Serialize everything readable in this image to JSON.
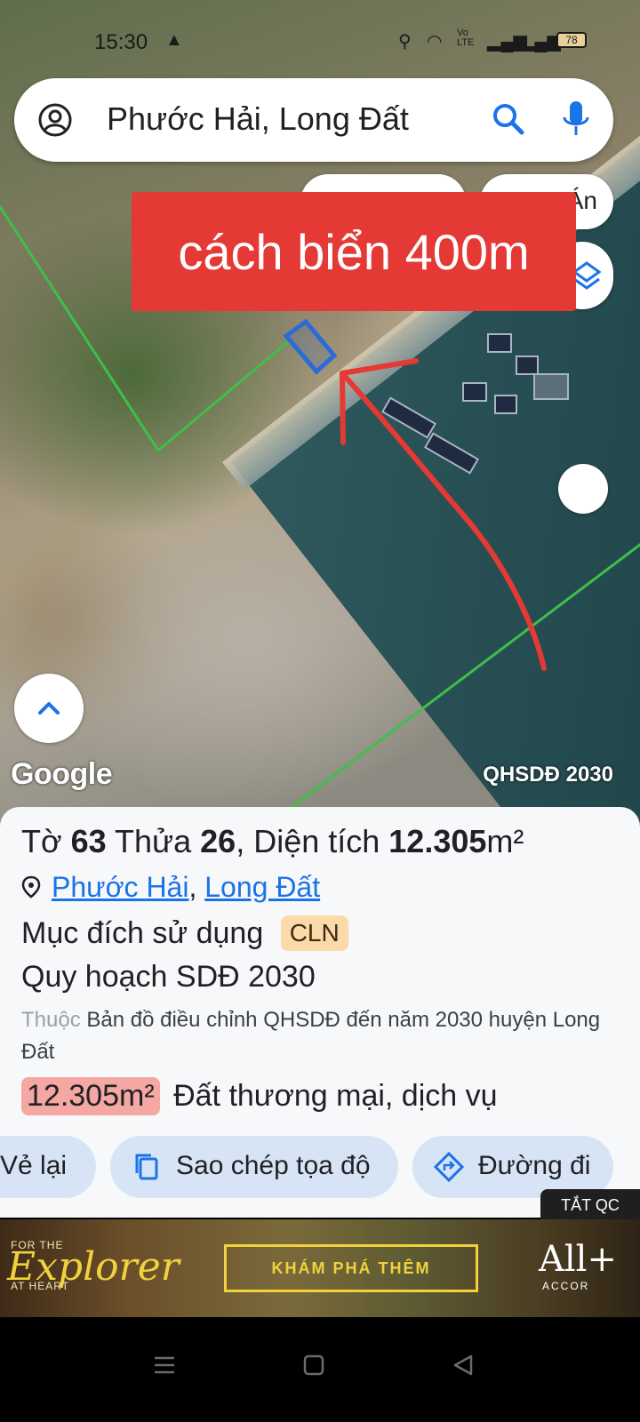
{
  "status": {
    "time": "15:30",
    "battery": "78",
    "network": "Vo LTE"
  },
  "search": {
    "query": "Phước Hải, Long Đất"
  },
  "map": {
    "chip_right_label": "Án",
    "banner_text": "cách biển 400m",
    "google_label": "Google",
    "plan_label": "QHSDĐ 2030"
  },
  "sheet": {
    "parcel_prefix": "Tờ ",
    "sheet_no": "63",
    "parcel_mid": " Thửa ",
    "parcel_no": "26",
    "area_prefix": ", Diện tích ",
    "area_value": "12.305",
    "area_unit": "m²",
    "ward": "Phước Hải",
    "separator": ", ",
    "district": "Long Đất",
    "purpose_label": "Mục đích sử dụng",
    "purpose_code": "CLN",
    "plan_title": "Quy hoạch SDĐ 2030",
    "belong_prefix": "Thuộc",
    "belong_text": " Bản đồ điều chỉnh QHSDĐ đến năm 2030 huyện Long Đất",
    "zone_area": "12.305m²",
    "zone_name": "Đất thương mại, dịch vụ"
  },
  "actions": {
    "redraw": "Vẻ lại",
    "copy_coords": "Sao chép tọa độ",
    "directions": "Đường đi"
  },
  "ad": {
    "close_label": "TẮT QC",
    "for_the": "FOR THE",
    "explorer": "Explorer",
    "at_heart": "AT HEART",
    "cta": "KHÁM PHÁ THÊM",
    "brand": "All+",
    "brand_sub": "ACCOR"
  },
  "colors": {
    "accent_blue": "#1a73e8",
    "banner_red": "#e53935",
    "boundary_green": "#3fbf4a",
    "badge_orange": "#fcd9a8",
    "badge_red": "#f4a7a3",
    "action_bg": "#d7e4f6"
  }
}
